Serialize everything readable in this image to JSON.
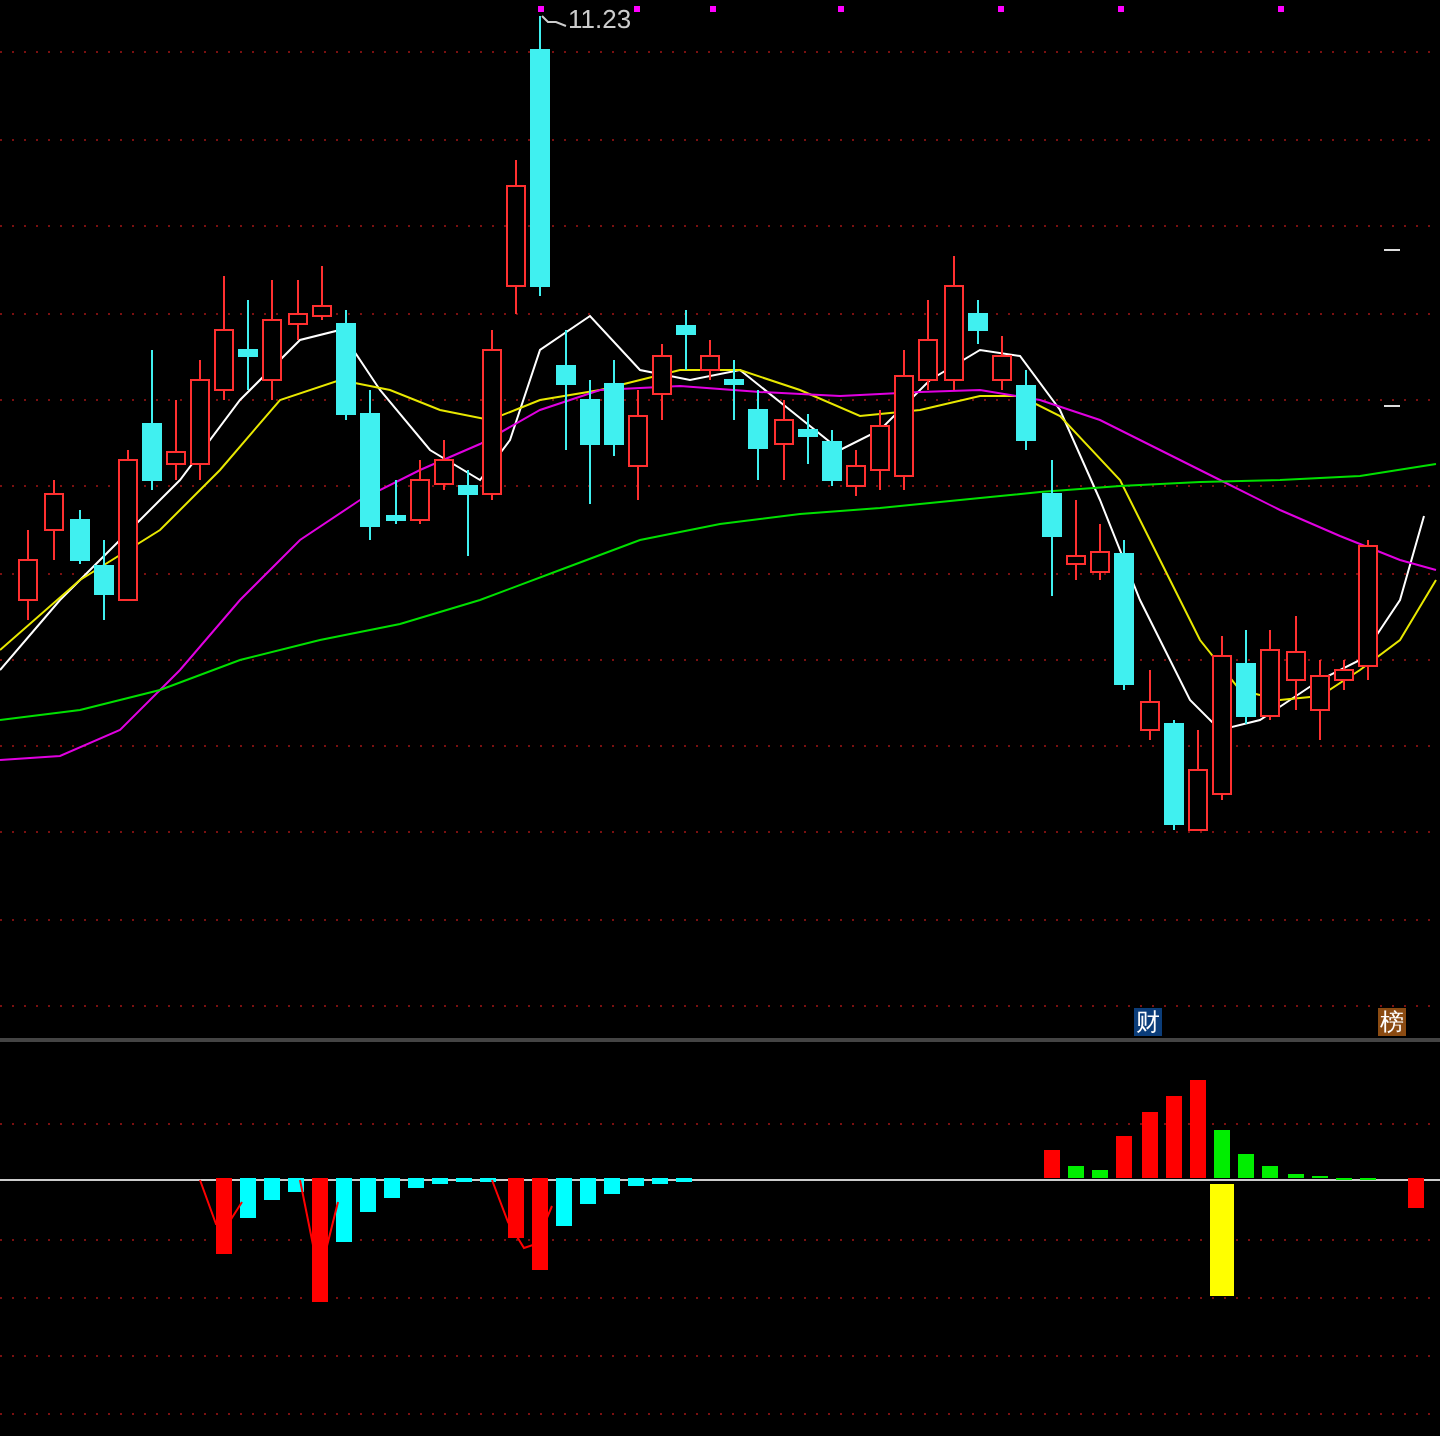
{
  "chart": {
    "high_label": "11.23"
  },
  "badges": [
    {
      "text": "财",
      "color": "#0b3d7a"
    },
    {
      "text": "榜",
      "color": "#8b4b12"
    }
  ]
}
